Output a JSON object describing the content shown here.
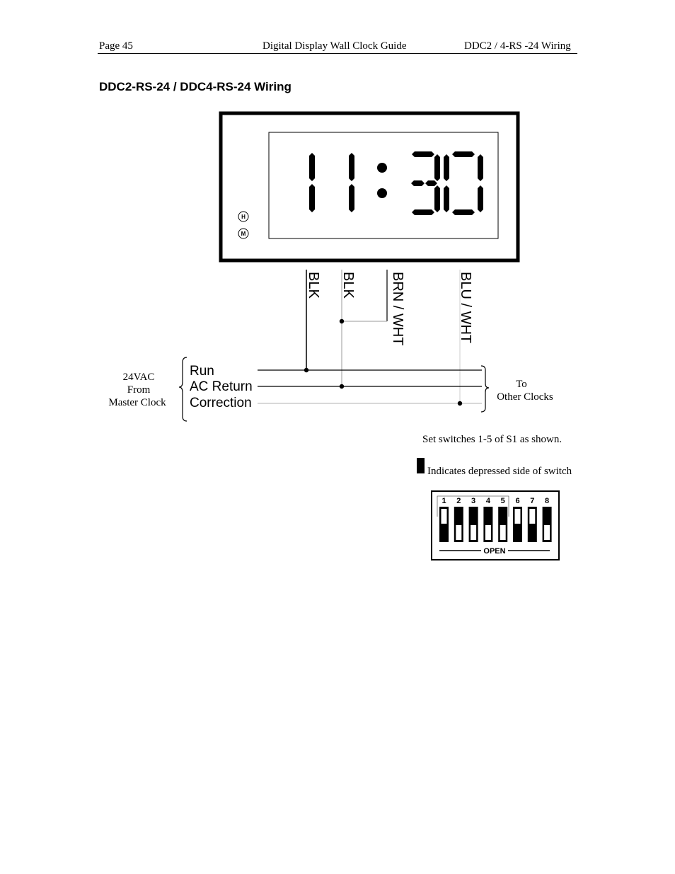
{
  "header": {
    "page": "Page 45",
    "doc_title": "Digital Display Wall Clock Guide",
    "section": "DDC2 / 4-RS -24 Wiring"
  },
  "title": "DDC2-RS-24 / DDC4-RS-24 Wiring",
  "clock": {
    "display_time": "11:30",
    "button_h": "H",
    "button_m": "M"
  },
  "wires": [
    "BLK",
    "BLK",
    "BRN / WHT",
    "BLU / WHT"
  ],
  "source": {
    "line1": "24VAC",
    "line2": "From",
    "line3": "Master Clock"
  },
  "bus_lines": [
    "Run",
    "AC Return",
    "Correction"
  ],
  "destination": {
    "line1": "To",
    "line2": "Other Clocks"
  },
  "switch_note": "Set switches 1-5 of S1 as shown.",
  "legend_note": "Indicates depressed side of switch",
  "dip_switch": {
    "label": "OPEN",
    "switches": [
      {
        "number": "1",
        "depressed": "bottom"
      },
      {
        "number": "2",
        "depressed": "top"
      },
      {
        "number": "3",
        "depressed": "top"
      },
      {
        "number": "4",
        "depressed": "top"
      },
      {
        "number": "5",
        "depressed": "top"
      },
      {
        "number": "6",
        "depressed": "bottom"
      },
      {
        "number": "7",
        "depressed": "bottom"
      },
      {
        "number": "8",
        "depressed": "top"
      }
    ]
  }
}
